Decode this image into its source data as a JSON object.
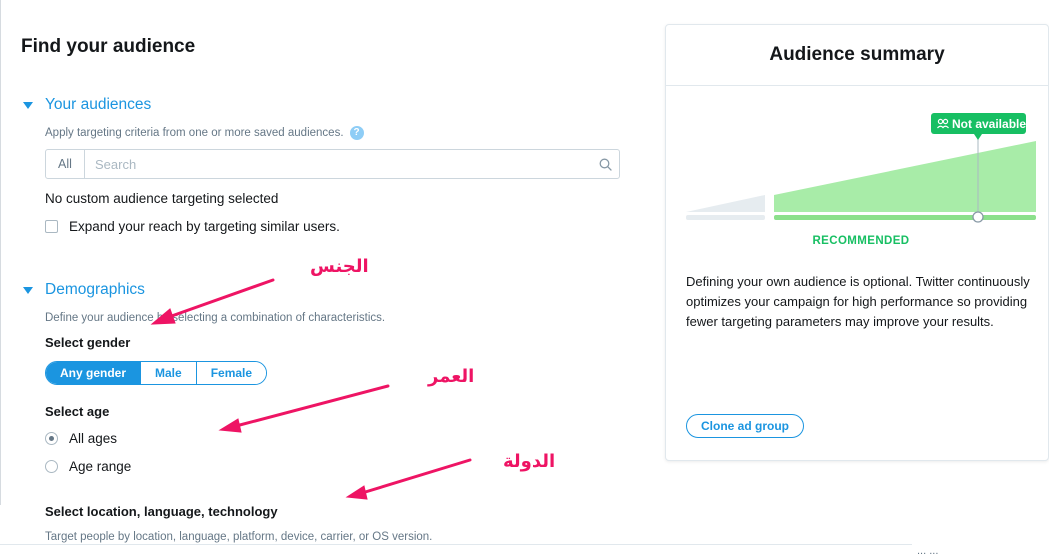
{
  "main": {
    "title": "Find your audience",
    "your_audiences": {
      "heading": "Your audiences",
      "hint": "Apply targeting criteria from one or more saved audiences.",
      "help_icon_text": "?",
      "search_scope": "All",
      "search_placeholder": "Search",
      "search_value": "",
      "no_targeting_text": "No custom audience targeting selected",
      "expand_reach_label": "Expand your reach by targeting similar users.",
      "expand_reach_checked": false
    },
    "demographics": {
      "heading": "Demographics",
      "hint": "Define your audience by selecting a combination of characteristics.",
      "gender": {
        "label": "Select gender",
        "options": [
          "Any gender",
          "Male",
          "Female"
        ],
        "selected": "Any gender"
      },
      "age": {
        "label": "Select age",
        "options": [
          "All ages",
          "Age range"
        ],
        "selected": "All ages"
      },
      "location": {
        "label": "Select location, language, technology",
        "hint": "Target people by location, language, platform, device, carrier, or OS version."
      }
    }
  },
  "summary": {
    "title": "Audience summary",
    "badge": "Not available",
    "recommended_label": "RECOMMENDED",
    "description": "Defining your own audience is optional. Twitter continuously optimizes your campaign for high performance so providing fewer targeting parameters may improve your results.",
    "clone_button": "Clone ad group"
  },
  "annotations": {
    "gender": "الجنس",
    "age": "العمر",
    "country": "الدولة"
  },
  "footer": {
    "fragment": "... ..."
  },
  "colors": {
    "accent": "#1b95e0",
    "recommended_green": "#17bf63",
    "gauge_fill": "#a8eca8",
    "annotation_pink": "#ee1464",
    "text": "#14171a",
    "muted": "#657786"
  },
  "icons": {
    "section_toggle": "caret-down-icon",
    "search": "search-icon",
    "help": "question-circle-icon",
    "audience_badge": "people-icon"
  }
}
